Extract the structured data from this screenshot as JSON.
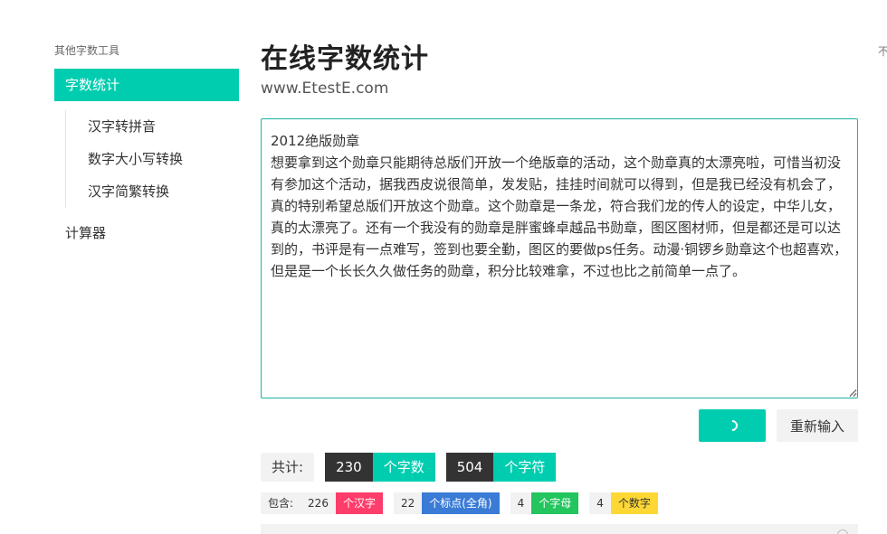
{
  "sidebar": {
    "heading": "其他字数工具",
    "active_item": "字数统计",
    "sub_items": [
      "汉字转拼音",
      "数字大小写转换",
      "汉字简繁转换"
    ],
    "calculator": "计算器"
  },
  "edge_text": "不",
  "header": {
    "title": "在线字数统计",
    "subtitle": "www.EtestE.com"
  },
  "editor": {
    "value": "2012绝版勋章\n想要拿到这个勋章只能期待总版们开放一个绝版章的活动，这个勋章真的太漂亮啦，可惜当初没有参加这个活动，据我西皮说很简单，发发贴，挂挂时间就可以得到，但是我已经没有机会了，真的特别希望总版们开放这个勋章。这个勋章是一条龙，符合我们龙的传人的设定，中华儿女，真的太漂亮了。还有一个我没有的勋章是胖蜜蜂卓越品书勋章，图区图材师，但是都还是可以达到的，书评是有一点难写，签到也要全勤，图区的要做ps任务。动漫·铜锣乡勋章这个也超喜欢，但是是一个长长久久做任务的勋章，积分比较难拿，不过也比之前简单一点了。"
  },
  "buttons": {
    "reset_label": "重新输入"
  },
  "totals": {
    "label": "共计:",
    "chars_count": "230",
    "chars_unit": "个字数",
    "symbols_count": "504",
    "symbols_unit": "个字符"
  },
  "details": {
    "label": "包含:",
    "items": [
      {
        "count": "226",
        "tag": "个汉字",
        "color": "#ff3d6b"
      },
      {
        "count": "22",
        "tag": "个标点(全角)",
        "color": "#3a7bd5"
      },
      {
        "count": "4",
        "tag": "个字母",
        "color": "#22c55e"
      },
      {
        "count": "4",
        "tag": "个数字",
        "color": "#fdd835"
      }
    ]
  },
  "colors": {
    "accent": "#00cdb0",
    "dark": "#333333",
    "border": "#18b3a0"
  }
}
